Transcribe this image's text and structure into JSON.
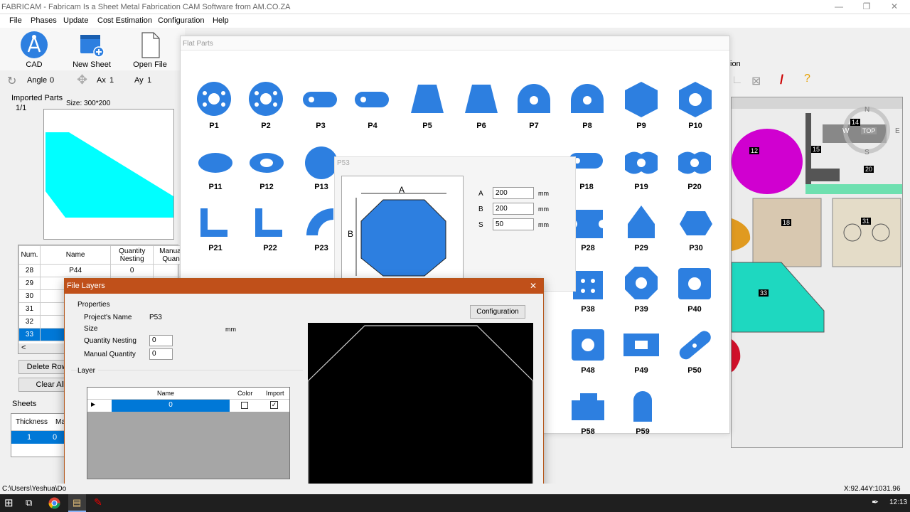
{
  "window": {
    "title": "FABRICAM - Fabricam Is a Sheet Metal Fabrication CAM Software from AM.CO.ZA"
  },
  "menu": [
    "File",
    "Phases",
    "Update",
    "Cost Estimation",
    "Configuration",
    "Help"
  ],
  "toolbar": {
    "cad": "CAD",
    "new_sheet": "New Sheet",
    "open_file": "Open File"
  },
  "params": {
    "angle_label": "Angle",
    "angle_value": "0",
    "ax_label": "Ax",
    "ax_value": "1",
    "ay_label": "Ay",
    "ay_value": "1"
  },
  "imported": {
    "title": "Imported Parts",
    "page": "1/1",
    "size": "Size: 300*200"
  },
  "parts_table": {
    "headers": [
      "Num.",
      "Name",
      "Quantity Nesting",
      "Manual Quan"
    ],
    "rows": [
      [
        "28",
        "P44",
        "0"
      ],
      [
        "29",
        "",
        ""
      ],
      [
        "30",
        "",
        ""
      ],
      [
        "31",
        "",
        ""
      ],
      [
        "32",
        "",
        ""
      ],
      [
        "33",
        "",
        ""
      ]
    ],
    "scroll_left": "<"
  },
  "buttons": {
    "delete_row": "Delete Row F",
    "clear_all": "Clear All"
  },
  "sheets": {
    "title": "Sheets",
    "headers": [
      "Thickness",
      "Mat"
    ],
    "row": [
      "1",
      "0"
    ]
  },
  "flat_parts": {
    "title": "Flat Parts",
    "labels": [
      "P1",
      "P2",
      "P3",
      "P4",
      "P5",
      "P6",
      "P7",
      "P8",
      "P9",
      "P10",
      "P11",
      "P12",
      "P13",
      "P18",
      "P19",
      "P20",
      "P21",
      "P22",
      "P23",
      "P28",
      "P29",
      "P30",
      "P38",
      "P39",
      "P40",
      "P48",
      "P49",
      "P50",
      "P58",
      "P59"
    ]
  },
  "p53": {
    "title": "P53",
    "dim_a": "A",
    "dim_b": "B",
    "fields": [
      {
        "label": "A",
        "value": "200",
        "unit": "mm"
      },
      {
        "label": "B",
        "value": "200",
        "unit": "mm"
      },
      {
        "label": "S",
        "value": "50",
        "unit": "mm"
      }
    ]
  },
  "file_layers": {
    "title": "File Layers",
    "close": "✕",
    "properties_label": "Properties",
    "project_name_label": "Project's Name",
    "project_name": "P53",
    "size_label": "Size",
    "size_unit": "mm",
    "qty_nesting_label": "Quantity  Nesting",
    "qty_nesting": "0",
    "manual_qty_label": "Manual Quantity",
    "manual_qty": "0",
    "configuration_button": "Configuration",
    "layer_label": "Layer",
    "layer_headers": [
      "Name",
      "Color",
      "Import"
    ],
    "layer_row": {
      "name": "0",
      "color_checked": false,
      "import_checked": true
    }
  },
  "canvas": {
    "labels": [
      "12",
      "15",
      "14",
      "20",
      "18",
      "31",
      "33"
    ],
    "compass": {
      "n": "N",
      "s": "S",
      "w": "W",
      "e": "E",
      "top": "TOP"
    }
  },
  "right_menu_fragment": "ion",
  "status": {
    "path": "C:\\Users\\Yeshua\\Do",
    "coords": "X:92.44Y:1031.96"
  },
  "taskbar": {
    "time": "12:13"
  },
  "colors": {
    "part_blue": "#2d7fe0",
    "dialog_caption": "#c0501a",
    "selection": "#0078d7"
  }
}
